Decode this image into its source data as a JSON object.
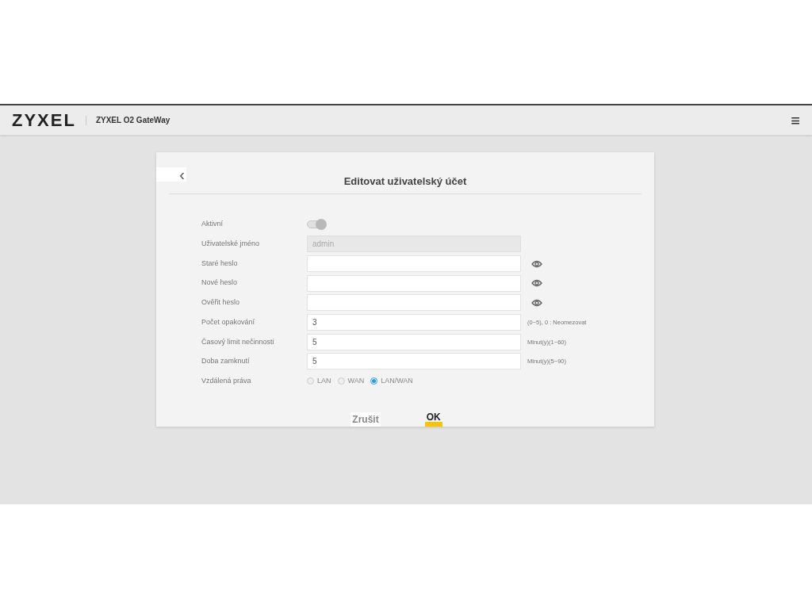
{
  "header": {
    "logo": "ZYXEL",
    "product": "ZYXEL O2 GateWay",
    "menu_icon": "≡"
  },
  "dialog": {
    "back": "‹",
    "title": "Editovat uživatelský účet",
    "rows": [
      {
        "kind": "toggle",
        "label": "Aktivní",
        "on": true,
        "disabled": true
      },
      {
        "kind": "text",
        "label": "Uživatelské jméno",
        "value": "admin",
        "disabled": true
      },
      {
        "kind": "password",
        "label": "Staré heslo",
        "value": ""
      },
      {
        "kind": "password",
        "label": "Nové heslo",
        "value": ""
      },
      {
        "kind": "password",
        "label": "Ověřit heslo",
        "value": ""
      },
      {
        "kind": "text",
        "label": "Počet opakování",
        "value": "3",
        "hint": "(0~5), 0 : Neomezovat",
        "disabled": false
      },
      {
        "kind": "text",
        "label": "Časový limit nečinnosti",
        "value": "5",
        "hint": "Minut(y)(1~60)",
        "disabled": false
      },
      {
        "kind": "text",
        "label": "Doba zamknutí",
        "value": "5",
        "hint": "Minut(y)(5~90)",
        "disabled": false
      },
      {
        "kind": "radio",
        "label": "Vzdálená práva",
        "options": [
          {
            "label": "LAN",
            "selected": false
          },
          {
            "label": "WAN",
            "selected": false
          },
          {
            "label": "LAN/WAN",
            "selected": true
          }
        ]
      }
    ],
    "buttons": [
      {
        "label": "Zrušit",
        "kind": "cancel"
      },
      {
        "label": "OK",
        "kind": "primary"
      }
    ]
  }
}
